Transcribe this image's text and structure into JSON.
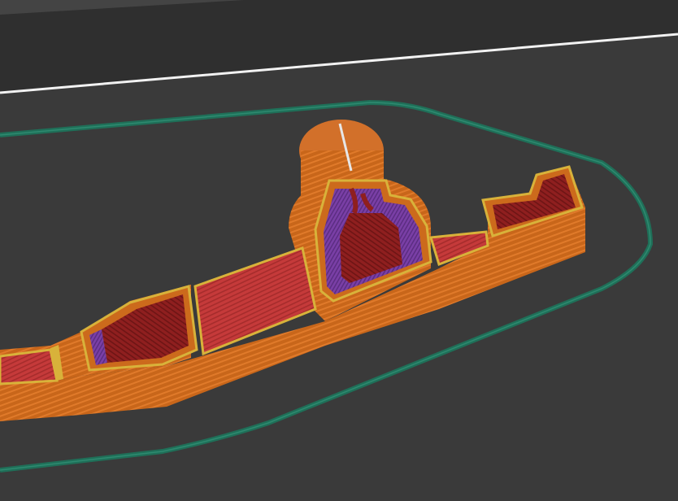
{
  "app": {
    "view": "G-code preview"
  },
  "colors": {
    "background_dark": "#2f2f2f",
    "bed_surface": "#3a3a3a",
    "bed_edge": "#f2f2f2",
    "skirt": "#1f6f58",
    "outer_wall": "#cc6a1c",
    "inner_wall": "#d8b23a",
    "solid_infill": "#8f1f1f",
    "top_solid_infill": "#c53a3a",
    "overhang_perimeter": "#7a3fa6",
    "seam_line": "#e6e6e6"
  },
  "icons": {
    "model": "sliced-model-icon"
  },
  "hud": {
    "label": ""
  }
}
